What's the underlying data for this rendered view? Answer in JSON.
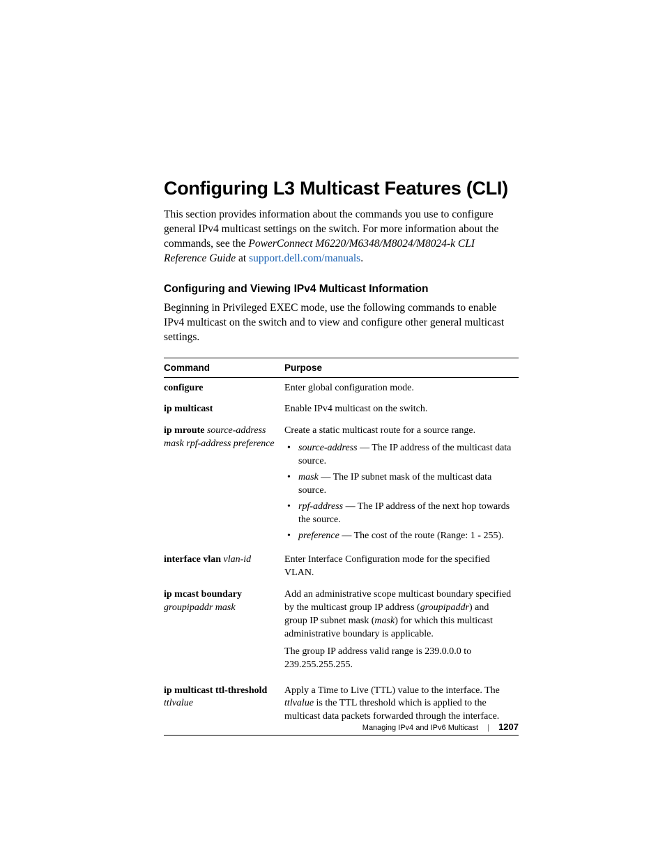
{
  "title": "Configuring L3 Multicast Features (CLI)",
  "intro_1": "This section provides information about the commands you use to configure general IPv4 multicast settings on the switch. For more information about the commands, see the ",
  "intro_italic": "PowerConnect M6220/M6348/M8024/M8024-k CLI Reference Guide",
  "intro_2": " at ",
  "intro_link": "support.dell.com/manuals",
  "intro_3": ".",
  "section_heading": "Configuring and Viewing IPv4 Multicast Information",
  "lead": "Beginning in Privileged EXEC mode, use the following commands to enable IPv4 multicast on the switch and to view and configure other general multicast settings.",
  "table": {
    "head_cmd": "Command",
    "head_purpose": "Purpose",
    "rows": [
      {
        "cmd_bold": "configure",
        "cmd_arg": "",
        "purpose_text": "Enter global configuration mode."
      },
      {
        "cmd_bold": "ip multicast",
        "cmd_arg": "",
        "purpose_text": "Enable IPv4 multicast on the switch."
      },
      {
        "cmd_bold": "ip mroute",
        "cmd_arg": " source-address mask rpf-address preference",
        "purpose_text": "Create a static multicast route for a source range.",
        "bullets": [
          {
            "arg": "source-address",
            "rest": " — The IP address of the multicast data source."
          },
          {
            "arg": "mask",
            "rest": " — The IP subnet mask of the multicast data source."
          },
          {
            "arg": "rpf-address",
            "rest": " — The IP address of the next hop towards the source."
          },
          {
            "arg": "preference",
            "rest": " — The cost of the route (Range:  1 - 255)."
          }
        ]
      },
      {
        "cmd_bold": "interface vlan",
        "cmd_arg": " vlan-id",
        "purpose_text": "Enter Interface Configuration mode for the specified VLAN."
      },
      {
        "cmd_bold": "ip mcast boundary",
        "cmd_arg": " groupipaddr mask",
        "purpose_special": true,
        "purpose_pre": "Add an administrative scope multicast boundary specified by the multicast group IP address (",
        "purpose_arg1": "groupipaddr",
        "purpose_mid": ") and group IP subnet mask (",
        "purpose_arg2": "mask",
        "purpose_post": ") for which this multicast administrative boundary is applicable.",
        "purpose_text2": "The group IP address valid range is 239.0.0.0 to 239.255.255.255."
      },
      {
        "cmd_bold": "ip multicast ttl-threshold",
        "cmd_arg": " ttlvalue",
        "purpose_ttl": true,
        "purpose_pre": "Apply a Time to Live (TTL) value to the interface. The ",
        "purpose_arg1": "ttlvalue",
        "purpose_post": " is the TTL threshold which is applied to the multicast data packets forwarded through the interface."
      }
    ]
  },
  "footer": {
    "chapter": "Managing IPv4 and IPv6 Multicast",
    "page": "1207"
  }
}
